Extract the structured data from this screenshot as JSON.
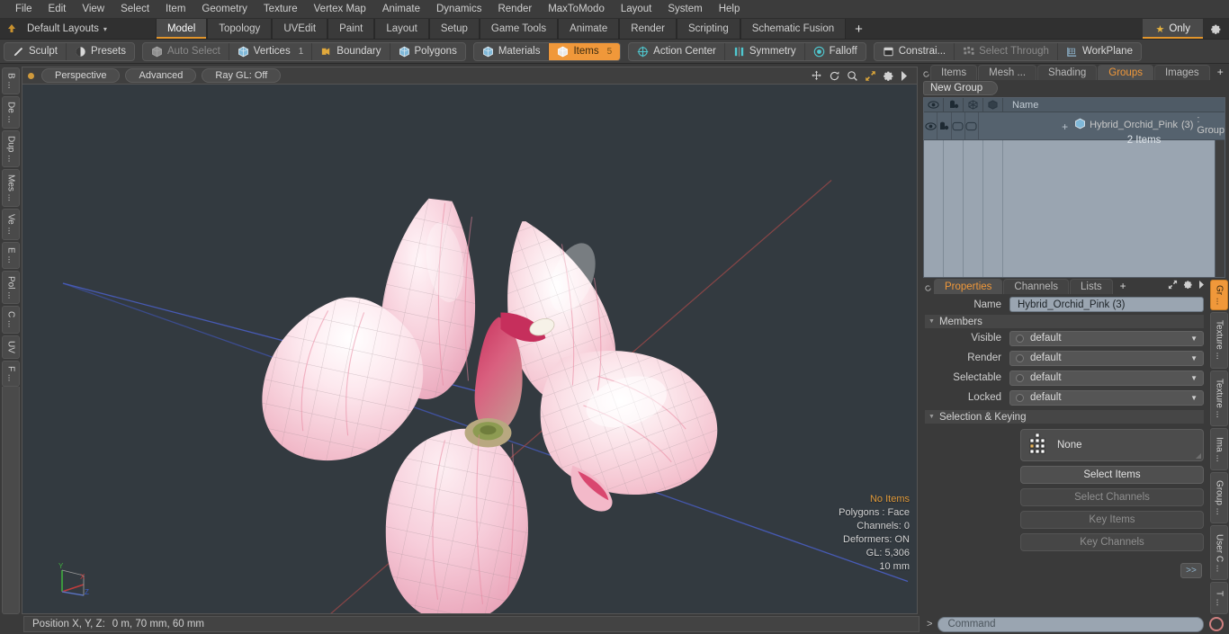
{
  "menu": {
    "items": [
      "File",
      "Edit",
      "View",
      "Select",
      "Item",
      "Geometry",
      "Texture",
      "Vertex Map",
      "Animate",
      "Dynamics",
      "Render",
      "MaxToModo",
      "Layout",
      "System",
      "Help"
    ]
  },
  "layout_bar": {
    "home_icon": "home-arrow-icon",
    "preset_label": "Default Layouts",
    "caret": "▾",
    "tabs": [
      "Model",
      "Topology",
      "UVEdit",
      "Paint",
      "Layout",
      "Setup",
      "Game Tools",
      "Animate",
      "Render",
      "Scripting",
      "Schematic Fusion"
    ],
    "active_tab": "Model",
    "add_tab_label": "+",
    "only_label": "Only",
    "only_star": "★",
    "gear_icon": "gear-icon",
    "accent_color": "#e2952c"
  },
  "toolbar": {
    "group1": [
      {
        "label": "Sculpt",
        "icon": "pencil-icon",
        "state": "normal"
      },
      {
        "label": "Presets",
        "icon": "sphere-icon",
        "state": "normal"
      }
    ],
    "group2": [
      {
        "label": "Auto Select",
        "icon": "cube-grey-icon",
        "state": "dim",
        "count": ""
      },
      {
        "label": "Vertices",
        "icon": "cube-blue-icon",
        "state": "normal",
        "count": "1"
      },
      {
        "label": "Boundary",
        "icon": "boundary-icon",
        "state": "normal",
        "count": ""
      },
      {
        "label": "Polygons",
        "icon": "cube-blue-icon",
        "state": "normal",
        "count": ""
      }
    ],
    "group3": [
      {
        "label": "Materials",
        "icon": "cube-blue-icon",
        "state": "normal",
        "count": ""
      },
      {
        "label": "Items",
        "icon": "cube-white-icon",
        "state": "active",
        "count": "5"
      }
    ],
    "group4": [
      {
        "label": "Action Center",
        "icon": "crosshair-icon",
        "state": "normal"
      },
      {
        "label": "Symmetry",
        "icon": "symmetry-icon",
        "state": "normal"
      },
      {
        "label": "Falloff",
        "icon": "falloff-icon",
        "state": "normal"
      }
    ],
    "group5": [
      {
        "label": "Constrai...",
        "icon": "constraint-icon",
        "state": "normal"
      },
      {
        "label": "Select Through",
        "icon": "select-through-icon",
        "state": "dim"
      },
      {
        "label": "WorkPlane",
        "icon": "workplane-icon",
        "state": "normal"
      }
    ]
  },
  "left_strip": {
    "tabs": [
      "B ...",
      "De ...",
      "Dup ...",
      "Mes ...",
      "Ve ...",
      "E ...",
      "Pol ...",
      "C ...",
      "UV",
      "F ..."
    ]
  },
  "viewport": {
    "header": {
      "dot_color": "#d09a3c",
      "pills": [
        "Perspective",
        "Advanced",
        "Ray GL: Off"
      ],
      "icons": [
        "move-icon",
        "rotate-icon",
        "zoom-icon",
        "fit-icon",
        "gear-icon",
        "play-arrow-icon"
      ]
    },
    "stats": [
      {
        "text": "No Items",
        "highlight": true
      },
      {
        "text": "Polygons : Face",
        "highlight": false
      },
      {
        "text": "Channels: 0",
        "highlight": false
      },
      {
        "text": "Deformers: ON",
        "highlight": false
      },
      {
        "text": "GL: 5,306",
        "highlight": false
      },
      {
        "text": "10 mm",
        "highlight": false
      }
    ],
    "gizmo": {
      "x_label": "X",
      "y_label": "Y",
      "z_label": "Z"
    },
    "background_color": "#333a40",
    "model_name": "pink hybrid orchid flower wireframe mesh"
  },
  "status": {
    "position_label": "Position X, Y, Z:",
    "position_value": "0 m, 70 mm, 60 mm"
  },
  "right_panel": {
    "tabs": [
      "Items",
      "Mesh ...",
      "Shading",
      "Groups",
      "Images"
    ],
    "active_tab": "Groups",
    "add_label": "+",
    "expand_icon": "expand-icon",
    "menu_icon": "play-arrow-icon",
    "new_group_label": "New Group",
    "item_list": {
      "columns": [
        "eye-icon",
        "render-icon",
        "wire-icon",
        "shade-icon"
      ],
      "name_header": "Name",
      "rows": [
        {
          "expander": "+",
          "icon": "group-cube-icon",
          "name": "Hybrid_Orchid_Pink",
          "count": "(3)",
          "type": ": Group",
          "sub": "2 Items"
        }
      ]
    }
  },
  "properties": {
    "tabs": [
      "Properties",
      "Channels",
      "Lists"
    ],
    "active_tab": "Properties",
    "add_label": "+",
    "name_label": "Name",
    "name_value": "Hybrid_Orchid_Pink (3)",
    "members_section": "Members",
    "members_rows": [
      {
        "label": "Visible",
        "value": "default"
      },
      {
        "label": "Render",
        "value": "default"
      },
      {
        "label": "Selectable",
        "value": "default"
      },
      {
        "label": "Locked",
        "value": "default"
      }
    ],
    "selection_section": "Selection & Keying",
    "selection_target": "None",
    "selection_target_icon": "hierarchy-icon",
    "buttons": [
      {
        "label": "Select Items",
        "enabled": true
      },
      {
        "label": "Select Channels",
        "enabled": false
      },
      {
        "label": "Key Items",
        "enabled": false
      },
      {
        "label": "Key Channels",
        "enabled": false
      }
    ],
    "more_label": ">>"
  },
  "right_strip": {
    "tabs": [
      "Gr ...",
      "Texture ...",
      "Texture ...",
      "Ima ...",
      "Group ...",
      "User C ...",
      "T ..."
    ],
    "active_tab": "Gr ..."
  },
  "command_bar": {
    "prompt": "&gt;",
    "placeholder": "Command",
    "record_icon": "record-icon"
  }
}
